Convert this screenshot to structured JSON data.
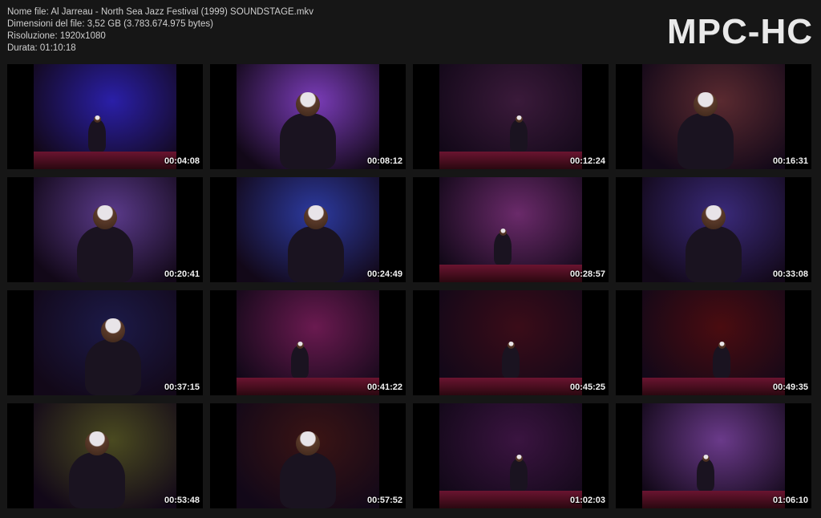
{
  "info": {
    "file_name": "Nome file: Al Jarreau - North Sea Jazz Festival (1999) SOUNDSTAGE.mkv",
    "file_size": "Dimensioni del file: 3,52 GB (3.783.674.975 bytes)",
    "resolution": "Risoluzione: 1920x1080",
    "duration": "Durata: 01:10:18"
  },
  "logo": "MPC-HC",
  "thumbnails": [
    {
      "time": "00:04:08",
      "scene": "wide-stage-blue",
      "bg": "#2a1fa8"
    },
    {
      "time": "00:08:12",
      "scene": "singer-purple",
      "bg": "#7a3cb8"
    },
    {
      "time": "00:12:24",
      "scene": "drummer",
      "bg": "#3a1a3a"
    },
    {
      "time": "00:16:31",
      "scene": "singer-close",
      "bg": "#5a2a30"
    },
    {
      "time": "00:20:41",
      "scene": "singer-close-mic",
      "bg": "#5a3a8a"
    },
    {
      "time": "00:24:49",
      "scene": "singer-blue",
      "bg": "#2c3aa0"
    },
    {
      "time": "00:28:57",
      "scene": "guitarists",
      "bg": "#6a2a6a"
    },
    {
      "time": "00:33:08",
      "scene": "singer-gesture",
      "bg": "#3a2a7a"
    },
    {
      "time": "00:37:15",
      "scene": "singer-dark",
      "bg": "#1c1a48"
    },
    {
      "time": "00:41:22",
      "scene": "stage-wide-red",
      "bg": "#6a1a50"
    },
    {
      "time": "00:45:25",
      "scene": "stage-dark-red",
      "bg": "#3a0c18"
    },
    {
      "time": "00:49:35",
      "scene": "stage-far-red",
      "bg": "#4a0c10"
    },
    {
      "time": "00:53:48",
      "scene": "singer-yellow",
      "bg": "#4a4a20"
    },
    {
      "time": "00:57:52",
      "scene": "singer-drums",
      "bg": "#3a1414"
    },
    {
      "time": "01:02:03",
      "scene": "percussionist",
      "bg": "#3a1440"
    },
    {
      "time": "01:06:10",
      "scene": "band-purple",
      "bg": "#6a3a8a"
    }
  ]
}
